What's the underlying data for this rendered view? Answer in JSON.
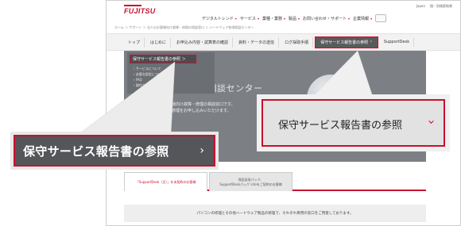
{
  "page": {
    "logo_text": "FUJITSU",
    "utility_links": [
      "Japan",
      "個・別検索結果"
    ],
    "global_nav": [
      {
        "label": "デジタルトレンド"
      },
      {
        "label": "サービス"
      },
      {
        "label": "業種・業務"
      },
      {
        "label": "製品"
      },
      {
        "label": "お問い合わせ・サポート"
      },
      {
        "label": "企業情報"
      }
    ],
    "breadcrumb": "ホーム ＞ サポート ＞ 法人のお客様向け故障・修理の相談窓口 ＞ ハードウェア修理相談センター",
    "local_nav": [
      {
        "label": "トップ",
        "active": false
      },
      {
        "label": "はじめに",
        "active": false
      },
      {
        "label": "お申込み内容・試算表の確認",
        "active": false
      },
      {
        "label": "資料・データの送信",
        "active": false
      },
      {
        "label": "ログ採取手順",
        "active": false
      },
      {
        "label": "保守サービス報告書の参照",
        "active": true
      },
      {
        "label": "SupportDesk",
        "active": false
      }
    ],
    "hero_title": "ードウェア修理相談センター",
    "hero_desc_1": "本サイトは、法人のお客様向け故障・修理の相談窓口です。",
    "hero_desc_2": "当社ハードウェア製品の修理をお申し込みいただけます。",
    "dropdown": {
      "heading": "保守サービス報告書の参照 ＞",
      "items": [
        "サービスについて",
        "必要な設定について",
        "FAQ",
        "操作ガイド"
      ]
    },
    "tabs": [
      {
        "label": "「SupportDesk（注）」を未契約のお客様",
        "active": true
      },
      {
        "label_1": "保証延長パック、",
        "label_2": "SupportDeskパック Liteをご契約のお客様",
        "active": false
      }
    ],
    "notice": "パソコンの修理とその他ハードウェア製品の修理で、それぞれ専用の窓口をご用意しております。"
  },
  "callouts": {
    "left_label": "保守サービス報告書の参照",
    "left_arrow": "›",
    "right_label": "保守サービス報告書の参照",
    "right_arrow": "›"
  },
  "colors": {
    "accent": "#c8102e",
    "hero_bg": "#7c7f84",
    "callout_left_bg": "#555659",
    "callout_right_bg": "#e2e2e2"
  },
  "icons": {
    "gnav_chevron": "chevron-down-icon",
    "callout_arrow": "chevron-right-icon"
  }
}
